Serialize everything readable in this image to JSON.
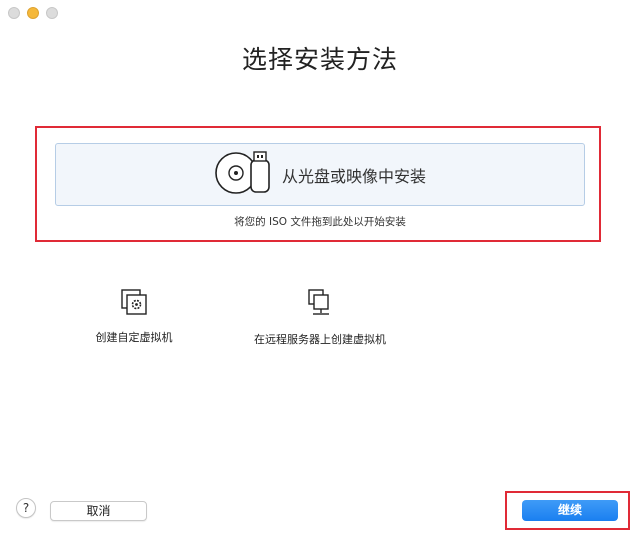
{
  "window": {
    "title": "选择安装方法"
  },
  "install_from_disc": {
    "label": "从光盘或映像中安装",
    "hint": "将您的 ISO 文件拖到此处以开始安装"
  },
  "options": [
    {
      "label": "创建自定虚拟机",
      "icon": "custom-vm-gear-icon"
    },
    {
      "label": "在远程服务器上创建虚拟机",
      "icon": "remote-server-icon"
    }
  ],
  "footer": {
    "help_label": "?",
    "cancel_label": "取消",
    "continue_label": "继续"
  },
  "colors": {
    "accent": "#1a7ff0",
    "highlight": "#e02a36",
    "drop_box_bg": "#f2f6fb",
    "drop_box_border": "#b6cde6"
  }
}
